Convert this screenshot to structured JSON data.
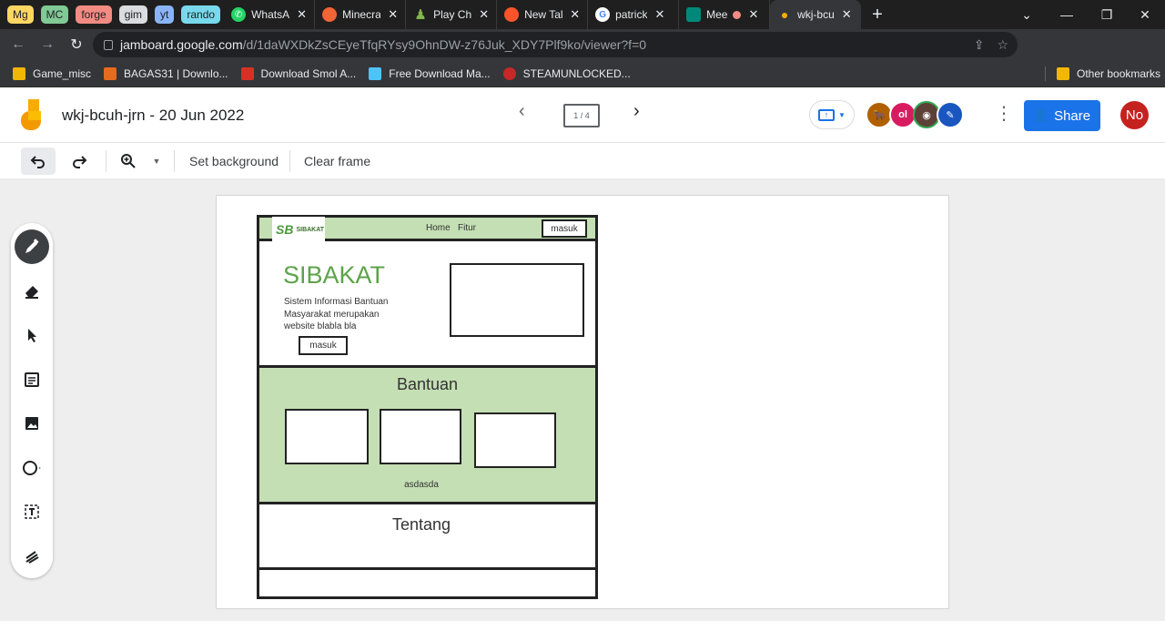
{
  "browser": {
    "tab_groups": [
      {
        "label": "Mg",
        "color": "#fdd663"
      },
      {
        "label": "MC",
        "color": "#81c995"
      },
      {
        "label": "forge",
        "color": "#f28b82"
      },
      {
        "label": "gim",
        "color": "#dadce0"
      },
      {
        "label": "yt",
        "color": "#8ab4f8"
      },
      {
        "label": "rando",
        "color": "#78d9ec"
      }
    ],
    "tabs": [
      {
        "title": "WhatsA",
        "icon": "whatsapp-icon",
        "color": "#25d366"
      },
      {
        "title": "Minecra",
        "icon": "curseforge-icon",
        "color": "#f16436"
      },
      {
        "title": "Play Che",
        "icon": "chess-pawn-icon",
        "color": "#81b64c"
      },
      {
        "title": "New Tal",
        "icon": "brave-icon",
        "color": "#fb542b"
      },
      {
        "title": "patrick",
        "icon": "google-icon",
        "color": "#ffffff"
      },
      {
        "title": "Mee",
        "icon": "meet-icon",
        "color": "#00897b"
      },
      {
        "title": "wkj-bcu",
        "icon": "jamboard-icon",
        "color": "#f9ab00"
      }
    ],
    "new_tab": "+",
    "url_host": "jamboard.google.com",
    "url_path": "/d/1daWXDkZsCEyeTfqRYsy9OhnDW-z76Juk_XDY7Plf9ko/viewer?f=0",
    "profile_initials": "No",
    "bookmarks": [
      {
        "label": "Game_misc",
        "icon": "folder-icon"
      },
      {
        "label": "BAGAS31 | Downlo...",
        "icon": "bagas-icon"
      },
      {
        "label": "Download Smol A...",
        "icon": "smol-icon"
      },
      {
        "label": "Free Download Ma...",
        "icon": "fdm-icon"
      },
      {
        "label": "STEAMUNLOCKED...",
        "icon": "steamunlocked-icon"
      }
    ],
    "other_bookmarks": "Other bookmarks"
  },
  "jamboard": {
    "title": "wkj-bcuh-jrn - 20 Jun 2022",
    "frame_indicator": "1 / 4",
    "share_label": "Share",
    "user_initials": "No",
    "toolbar": {
      "set_background": "Set background",
      "clear_frame": "Clear frame"
    }
  },
  "wireframe": {
    "logo_mark": "SB",
    "logo_text": "SIBAKAT",
    "nav_links": "Home   Fitur",
    "nav_button": "masuk",
    "hero_title": "SIBAKAT",
    "hero_text": "Sistem Informasi Bantuan Masyarakat merupakan website blabla bla",
    "hero_button": "masuk",
    "section1_title": "Bantuan",
    "section1_caption": "asdasda",
    "section2_title": "Tentang"
  }
}
